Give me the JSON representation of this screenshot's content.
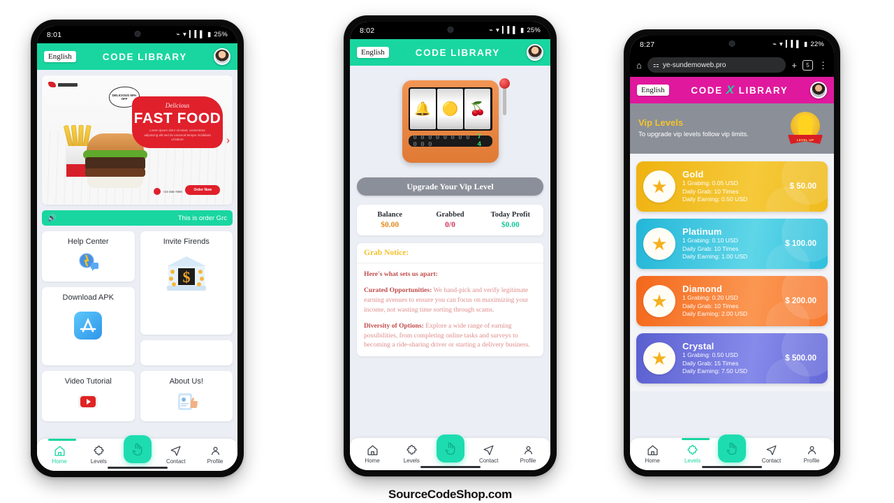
{
  "watermark": "SourceCodeShop.com",
  "colors": {
    "green": "#19d6a0",
    "pink": "#e0189e",
    "teal_fab": "#1ddcb0",
    "gold": "#f4c52c",
    "page_bg": "#eceef5"
  },
  "phone1": {
    "status": {
      "time": "8:01",
      "battery": "25%",
      "icons": [
        "bluetooth-icon",
        "wifi-icon",
        "signal-icon",
        "battery-icon"
      ]
    },
    "header": {
      "language": "English",
      "brand_left": "CODE",
      "brand_right": "LIBRARY",
      "avatar": "user-avatar"
    },
    "banner": {
      "logo_text": "LOGO HERE",
      "thought_text": "DELICIOUS 50% OFF",
      "script": "Delicious",
      "headline": "FAST FOOD",
      "sub": "Lorem ipsum dolor sit amet, consectetur adipiscing elit sed do eiusmod tempor incididunt ut labore",
      "phone": "+23-456-7890",
      "cta": "Order Now"
    },
    "marquee": {
      "icon": "speaker-icon",
      "text": "This is order Grc"
    },
    "tiles": [
      {
        "label": "Help Center",
        "icon": "help-chat-icon"
      },
      {
        "label": "Invite Firends",
        "icon": "bank-dollar-icon"
      },
      {
        "label": "Download APK",
        "icon": "appstore-icon"
      },
      {
        "label": "Video Tutorial",
        "icon": "youtube-icon"
      },
      {
        "label": "About Us!",
        "icon": "about-card-icon"
      }
    ],
    "nav": {
      "items": [
        {
          "label": "Home",
          "icon": "home-icon",
          "active": true
        },
        {
          "label": "Levels",
          "icon": "puzzle-icon",
          "active": false
        },
        {
          "label": "Contact",
          "icon": "send-icon",
          "active": false
        },
        {
          "label": "Profile",
          "icon": "person-icon",
          "active": false
        }
      ],
      "fab_icon": "hand-tap-icon"
    }
  },
  "phone2": {
    "status": {
      "time": "8:02",
      "battery": "25%"
    },
    "header": {
      "language": "English",
      "brand_left": "CODE",
      "brand_right": "LIBRARY"
    },
    "slot": {
      "reels": [
        "🔔",
        "🟡",
        "🍒"
      ],
      "counter_zeros": "0 0 0 0 0 0 0 0 0 0 0",
      "counter_green": "7 4",
      "lever_icon": "slot-lever-icon"
    },
    "upgrade_button": "Upgrade Your Vip Level",
    "stats": [
      {
        "key": "Balance",
        "value": "$0.00",
        "color": "#e08a1e"
      },
      {
        "key": "Grabbed",
        "value": "0/0",
        "color": "#d2365c"
      },
      {
        "key": "Today Profit",
        "value": "$0.00",
        "color": "#19c79a"
      }
    ],
    "notice": {
      "title": "Grab Notice:",
      "lead": "Here's what sets us apart:",
      "paragraphs": [
        {
          "strong": "Curated Opportunities:",
          "text": " We hand-pick and verify legitimate earning avenues to ensure you can focus on maximizing your income, not wasting time sorting through scams."
        },
        {
          "strong": "Diversity of Options:",
          "text": " Explore a wide range of earning possibilities, from completing online tasks and surveys to becoming a ride-sharing driver or starting a delivery business."
        }
      ]
    },
    "nav": {
      "items": [
        {
          "label": "Home",
          "icon": "home-icon",
          "active": false
        },
        {
          "label": "Levels",
          "icon": "puzzle-icon",
          "active": false
        },
        {
          "label": "Contact",
          "icon": "send-icon",
          "active": false
        },
        {
          "label": "Profile",
          "icon": "person-icon",
          "active": false
        }
      ],
      "fab_icon": "hand-tap-icon"
    }
  },
  "phone3": {
    "status": {
      "time": "8:27",
      "battery": "22%"
    },
    "browser": {
      "home_icon": "home-icon",
      "lock_icon": "site-settings-icon",
      "url": "ye-sundemoweb.pro",
      "new_tab_icon": "plus-icon",
      "tab_count": "5",
      "menu_icon": "more-vertical-icon"
    },
    "header": {
      "language": "English",
      "brand_left": "CODE",
      "brand_mark": "X",
      "brand_right": "LIBRARY"
    },
    "hero": {
      "title": "Vip Levels",
      "subtitle": "To upgrade vip levels follow vip limits.",
      "icon": "trophy-icon",
      "ribbon": "LEVEL UP"
    },
    "levels": [
      {
        "name": "Gold",
        "grabbing": "1 Grabing: 0.05 USD",
        "daily_grab": "Daily Grab: 10 Times",
        "daily_earning": "Daily Earning: 0.50 USD",
        "price": "$ 50.00",
        "theme": "vip-gold"
      },
      {
        "name": "Platinum",
        "grabbing": "1 Grabing: 0.10 USD",
        "daily_grab": "Daily Grab: 10 Times",
        "daily_earning": "Daily Earning: 1.00 USD",
        "price": "$ 100.00",
        "theme": "vip-platinum"
      },
      {
        "name": "Diamond",
        "grabbing": "1 Grabing: 0.20 USD",
        "daily_grab": "Daily Grab: 10 Times",
        "daily_earning": "Daily Earning: 2.00 USD",
        "price": "$ 200.00",
        "theme": "vip-diamond"
      },
      {
        "name": "Crystal",
        "grabbing": "1 Grabing: 0.50 USD",
        "daily_grab": "Daily Grab: 15 Times",
        "daily_earning": "Daily Earning: 7.50 USD",
        "price": "$ 500.00",
        "theme": "vip-crystal"
      }
    ],
    "nav": {
      "items": [
        {
          "label": "Home",
          "icon": "home-icon",
          "active": false
        },
        {
          "label": "Levels",
          "icon": "puzzle-icon",
          "active": true
        },
        {
          "label": "Contact",
          "icon": "send-icon",
          "active": false
        },
        {
          "label": "Profile",
          "icon": "person-icon",
          "active": false
        }
      ],
      "fab_icon": "hand-tap-icon"
    }
  }
}
